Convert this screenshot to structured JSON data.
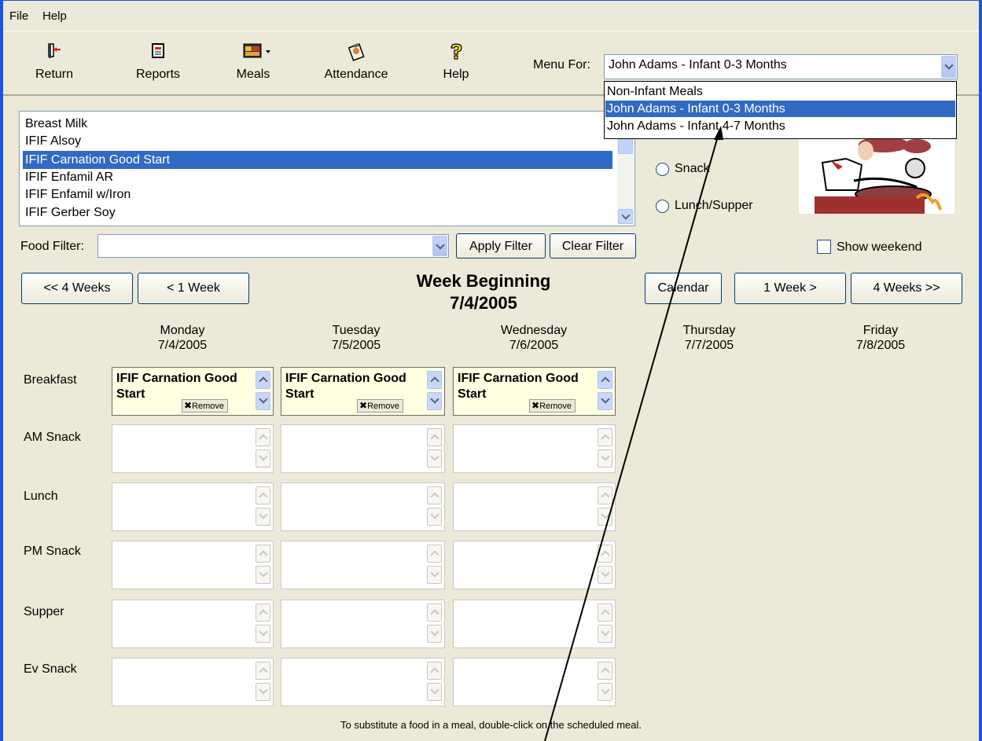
{
  "menubar": {
    "file": "File",
    "help": "Help"
  },
  "toolbar": {
    "return": "Return",
    "reports": "Reports",
    "meals": "Meals",
    "attendance": "Attendance",
    "help": "Help"
  },
  "menu_for": {
    "label": "Menu For:",
    "selected": "John Adams - Infant 0-3 Months",
    "options": [
      "Non-Infant Meals",
      "John Adams - Infant 0-3 Months",
      "John Adams - Infant 4-7 Months"
    ]
  },
  "foods": [
    "Breast Milk",
    "IFIF Alsoy",
    "IFIF Carnation Good Start",
    "IFIF Enfamil AR",
    "IFIF Enfamil w/Iron",
    "IFIF Gerber Soy"
  ],
  "meal_type_radios": [
    "Snack",
    "Lunch/Supper"
  ],
  "filter": {
    "label": "Food Filter:",
    "value": "",
    "apply": "Apply Filter",
    "clear": "Clear Filter"
  },
  "nav": {
    "back4": "<< 4 Weeks",
    "back1": "< 1 Week",
    "calendar": "Calendar",
    "fwd1": "1 Week >",
    "fwd4": "4 Weeks >>"
  },
  "show_weekend": {
    "label": "Show weekend",
    "checked": false
  },
  "week": {
    "title": "Week Beginning",
    "date": "7/4/2005"
  },
  "days": [
    {
      "name": "Monday",
      "date": "7/4/2005"
    },
    {
      "name": "Tuesday",
      "date": "7/5/2005"
    },
    {
      "name": "Wednesday",
      "date": "7/6/2005"
    },
    {
      "name": "Thursday",
      "date": "7/7/2005"
    },
    {
      "name": "Friday",
      "date": "7/8/2005"
    }
  ],
  "meal_rows": [
    "Breakfast",
    "AM Snack",
    "Lunch",
    "PM Snack",
    "Supper",
    "Ev Snack"
  ],
  "schedule": {
    "breakfast": [
      "IFIF Carnation Good Start",
      "IFIF Carnation Good Start",
      "IFIF Carnation Good Start"
    ]
  },
  "remove_label": "Remove",
  "footer": "To substitute a food in a meal, double-click on the scheduled meal."
}
